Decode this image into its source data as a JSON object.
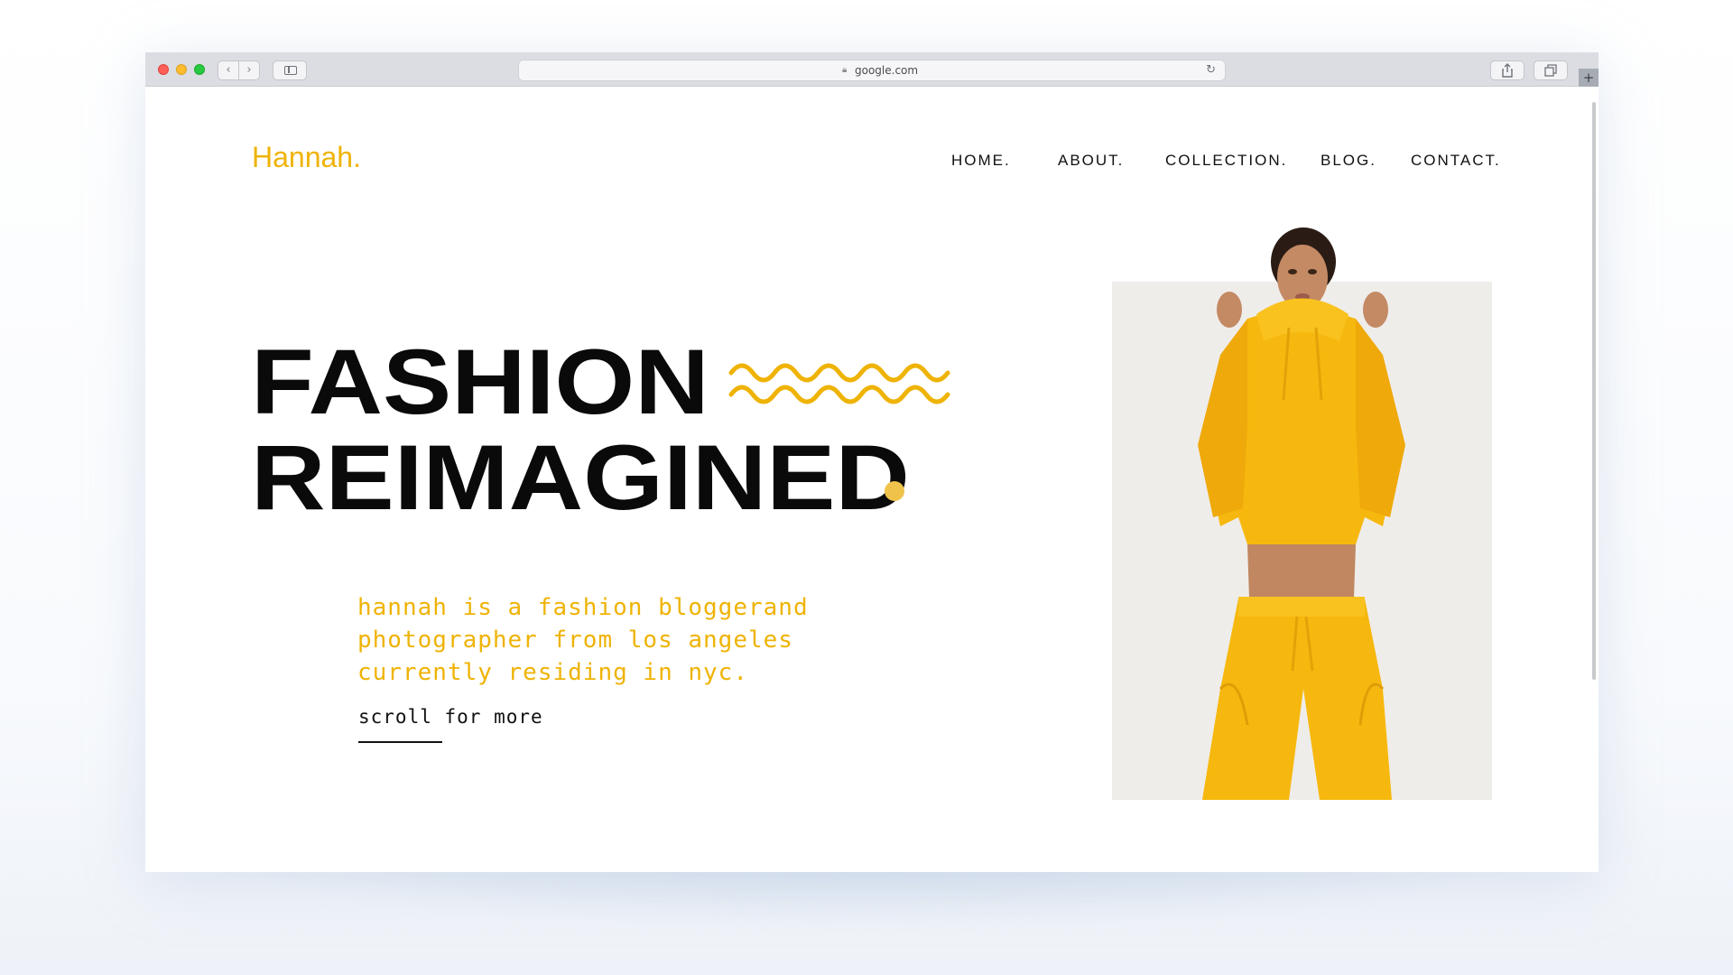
{
  "browser": {
    "url": "google.com",
    "icons": {
      "back": "chevron-left-icon",
      "forward": "chevron-right-icon",
      "sidebar": "sidebar-icon",
      "lock": "lock-icon",
      "reload": "reload-icon",
      "share": "share-icon",
      "tabs": "tabs-icon",
      "new_tab": "plus-icon"
    }
  },
  "site": {
    "logo": "Hannah.",
    "nav": [
      "HOME.",
      "ABOUT.",
      "COLLECTION.",
      "BLOG.",
      "CONTACT."
    ],
    "hero": {
      "line1": "FASHION",
      "line2": "REIMAGINED"
    },
    "tagline": [
      "hannah is a fashion bloggerand",
      "photographer from los angeles",
      "currently residing in nyc."
    ],
    "cta": "scroll for more",
    "photo_alt": "woman in yellow hoodie and sweatpants"
  },
  "colors": {
    "accent": "#efb305",
    "dot": "#efc24a",
    "text": "#0a0a0a",
    "photo_background": "#efedea"
  }
}
